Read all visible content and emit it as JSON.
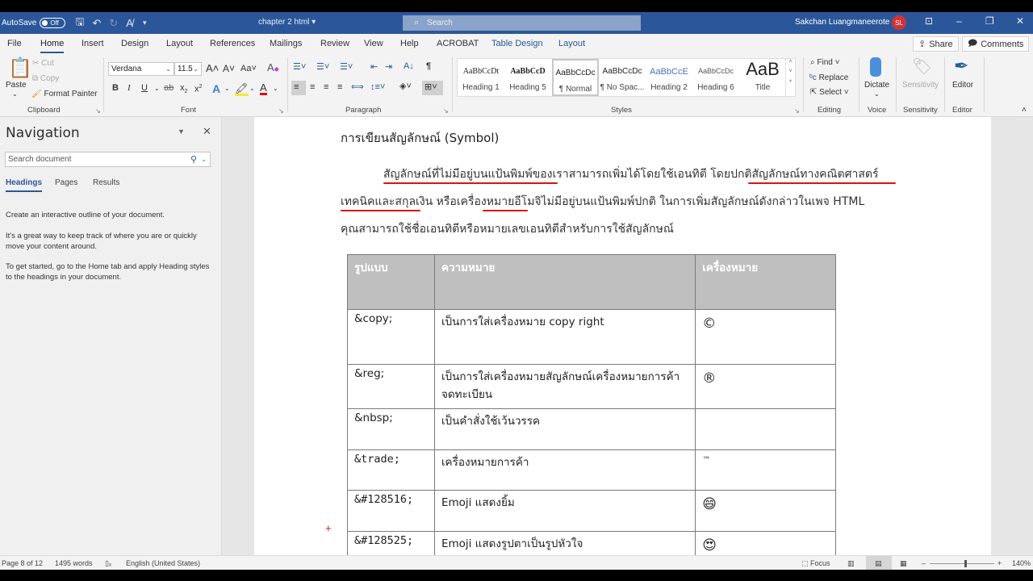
{
  "titlebar": {
    "autosave_label": "AutoSave",
    "autosave_state": "Off",
    "doc_title": "chapter 2 html",
    "search_placeholder": "Search",
    "user_name": "Sakchan Luangmaneerote",
    "user_initials": "SL"
  },
  "tabs": [
    "File",
    "Home",
    "Insert",
    "Design",
    "Layout",
    "References",
    "Mailings",
    "Review",
    "View",
    "Help",
    "ACROBAT",
    "Table Design",
    "Layout"
  ],
  "active_tab": "Home",
  "share_label": "Share",
  "comments_label": "Comments",
  "ribbon": {
    "clipboard": {
      "paste": "Paste",
      "cut": "Cut",
      "copy": "Copy",
      "format_painter": "Format Painter",
      "label": "Clipboard"
    },
    "font": {
      "name": "Verdana",
      "size": "11.5",
      "case_btn": "Aa",
      "label": "Font"
    },
    "paragraph": {
      "label": "Paragraph"
    },
    "styles": {
      "label": "Styles",
      "items": [
        {
          "preview": "AaBbCcDt",
          "name": "Heading 1"
        },
        {
          "preview": "AaBbCcD",
          "name": "Heading 5"
        },
        {
          "preview": "AaBbCcDc",
          "name": "¶ Normal"
        },
        {
          "preview": "AaBbCcDc",
          "name": "¶ No Spac..."
        },
        {
          "preview": "AaBbCcE",
          "name": "Heading 2"
        },
        {
          "preview": "AaBbCcDc",
          "name": "Heading 6"
        },
        {
          "preview": "AaB",
          "name": "Title"
        }
      ],
      "selected": "¶ Normal"
    },
    "editing": {
      "find": "Find",
      "replace": "Replace",
      "select": "Select",
      "label": "Editing"
    },
    "voice": {
      "dictate": "Dictate",
      "label": "Voice"
    },
    "sensitivity": {
      "button": "Sensitivity",
      "label": "Sensitivity"
    },
    "editor": {
      "button": "Editor",
      "label": "Editor"
    }
  },
  "navigation": {
    "title": "Navigation",
    "search_placeholder": "Search document",
    "tabs": [
      "Headings",
      "Pages",
      "Results"
    ],
    "active_tab": "Headings",
    "paragraphs": [
      "Create an interactive outline of your document.",
      "It's a great way to keep track of where you are or quickly move your content around.",
      "To get started, go to the Home tab and apply Heading styles to the headings in your document."
    ]
  },
  "document": {
    "heading": "การเขียนสัญลักษณ์ (Symbol)",
    "para_lines": [
      "สัญลักษณ์ที่ไม่มีอยู่บนแป้นพิมพ์ของเราสามารถเพิ่มได้โดยใช้เอนทิตี โดยปกติสัญลักษณ์ทางคณิตศาสตร์",
      "เทคนิคและสกุลเงิน หรือเครื่องหมายอีโมจิไม่มีอยู่บนแป้นพิมพ์ปกติ ในการเพิ่มสัญลักษณ์ดังกล่าวในเพจ HTML",
      "คุณสามารถใช้ชื่อเอนทิตีหรือหมายเลขเอนทิตีสำหรับการใช้สัญลักษณ์"
    ],
    "table": {
      "headers": [
        "รูปแบบ",
        "ความหมาย",
        "เครื่องหมาย"
      ],
      "rows": [
        {
          "entity": "&copy;",
          "meaning": "เป็นการใส่เครื่องหมาย  copy right",
          "symbol": "©"
        },
        {
          "entity": "&reg;",
          "meaning": "เป็นการใส่เครื่องหมายสัญลักษณ์เครื่องหมายการค้าจดทะเบียน",
          "symbol": "®"
        },
        {
          "entity": "&nbsp;",
          "meaning": "เป็นคำสั่งใช้เว้นวรรค",
          "symbol": ""
        },
        {
          "entity": "&trade;",
          "meaning": "เครื่องหมายการค้า",
          "symbol": "™"
        },
        {
          "entity": "&#128516;",
          "meaning": "Emoji แสดงยิ้ม",
          "symbol": "😄"
        },
        {
          "entity": "&#128525;",
          "meaning": "Emoji แสดงรูปตาเป็นรูปหัวใจ",
          "symbol": "😍"
        }
      ]
    }
  },
  "statusbar": {
    "page": "Page 8 of 12",
    "words": "1495 words",
    "language": "English (United States)",
    "focus": "Focus",
    "zoom": "140%",
    "zoom_percent": 140
  }
}
